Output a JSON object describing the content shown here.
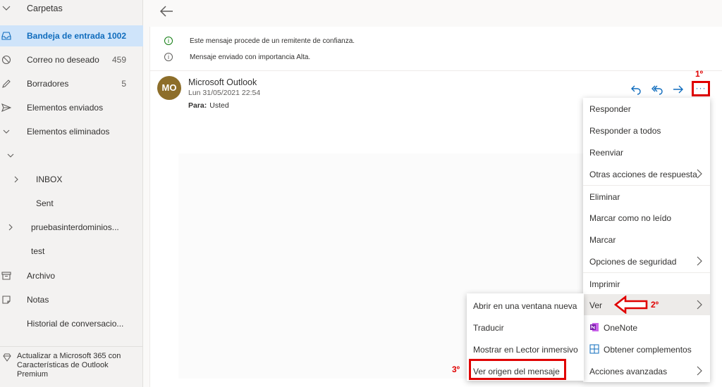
{
  "sidebar": {
    "header": "Carpetas",
    "items": [
      {
        "label": "Bandeja de entrada",
        "count": "1002",
        "icon": "inbox-icon"
      },
      {
        "label": "Correo no deseado",
        "count": "459",
        "icon": "junk-icon"
      },
      {
        "label": "Borradores",
        "count": "5",
        "icon": "pencil-icon"
      },
      {
        "label": "Elementos enviados",
        "count": "",
        "icon": "send-icon"
      },
      {
        "label": "Elementos eliminados",
        "count": "",
        "icon": "chevron-down-icon"
      },
      {
        "label": "",
        "count": "",
        "icon": "chevron-down-icon"
      },
      {
        "label": "INBOX",
        "count": "",
        "icon": "chevron-right-icon"
      },
      {
        "label": "Sent",
        "count": "",
        "icon": ""
      },
      {
        "label": "pruebasinterdominios...",
        "count": "",
        "icon": "chevron-right-icon"
      },
      {
        "label": "test",
        "count": "",
        "icon": ""
      },
      {
        "label": "Archivo",
        "count": "",
        "icon": "archive-icon"
      },
      {
        "label": "Notas",
        "count": "",
        "icon": "note-icon"
      },
      {
        "label": "Historial de conversacio...",
        "count": "",
        "icon": ""
      }
    ],
    "upgrade": "Actualizar a Microsoft 365 con Características de Outlook Premium"
  },
  "message": {
    "info1": "Este mensaje procede de un remitente de confianza.",
    "info2": "Mensaje enviado con importancia Alta.",
    "avatar_initials": "MO",
    "sender": "Microsoft Outlook",
    "date": "Lun 31/05/2021 22:54",
    "to_label": "Para:",
    "to_value": "Usted",
    "more": "···"
  },
  "menu": {
    "items": [
      "Responder",
      "Responder a todos",
      "Reenviar",
      "Otras acciones de respuesta",
      "Eliminar",
      "Marcar como no leído",
      "Marcar",
      "Opciones de seguridad",
      "Imprimir",
      "Ver",
      "OneNote",
      "Obtener complementos",
      "Acciones avanzadas"
    ]
  },
  "submenu": {
    "items": [
      "Abrir en una ventana nueva",
      "Traducir",
      "Mostrar en Lector inmersivo",
      "Ver origen del mensaje"
    ]
  },
  "annotations": {
    "step1": "1º",
    "step2": "2º",
    "step3": "3º"
  },
  "colors": {
    "accent": "#0f6cbd",
    "annotation": "#e00000",
    "avatar": "#8d6e2a",
    "active_bg": "#cfe4fa"
  }
}
